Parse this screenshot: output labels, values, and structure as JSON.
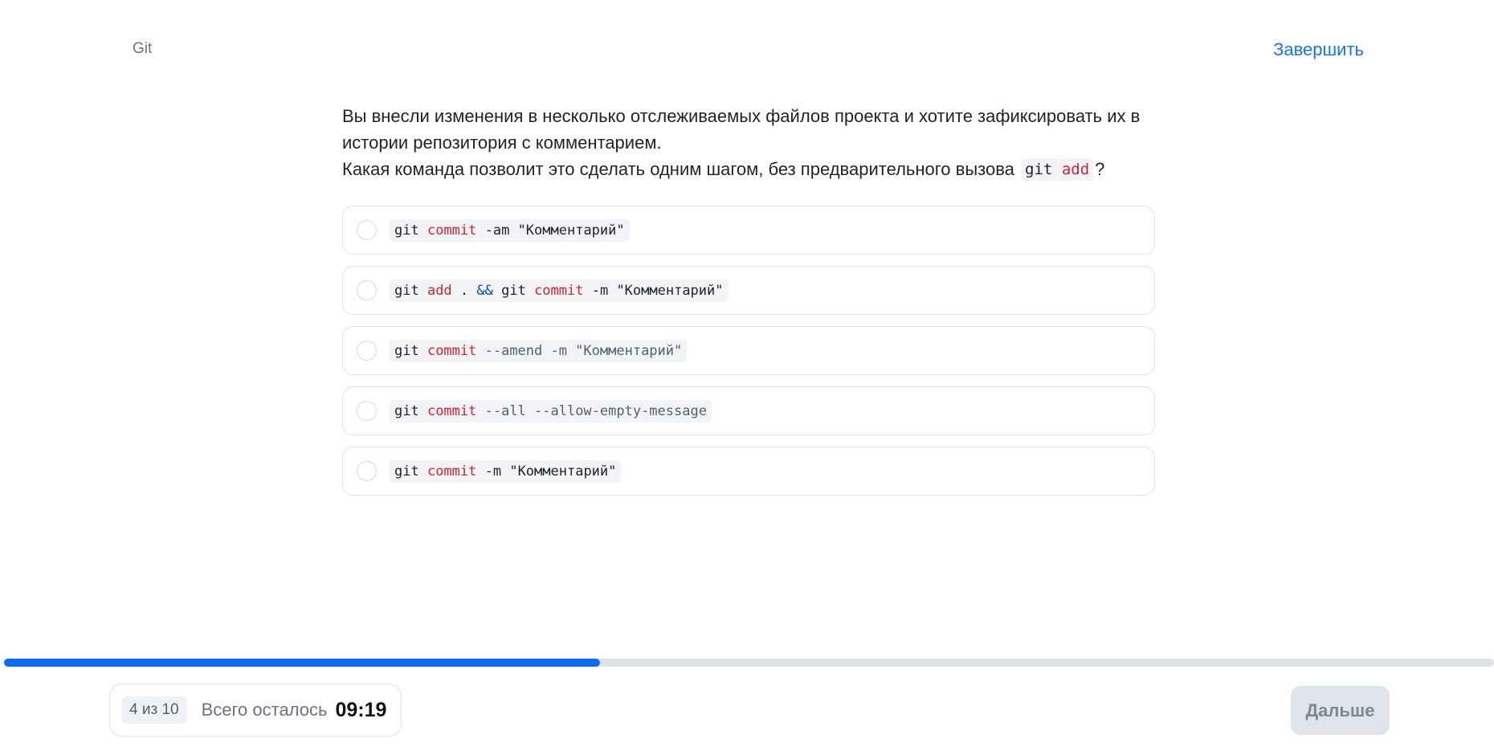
{
  "header": {
    "topic": "Git",
    "finish_label": "Завершить"
  },
  "question": {
    "line1": "Вы внесли изменения в несколько отслеживаемых файлов проекта и хотите зафиксировать их в",
    "line2": "истории репозитория с комментарием.",
    "line3_before": "Какая команда позволит это сделать одним шагом, без предварительного вызова",
    "code_git": "git",
    "code_add": "add",
    "line3_after": "?"
  },
  "options": [
    {
      "tokens": [
        {
          "t": "git ",
          "c": "plain"
        },
        {
          "t": "commit",
          "c": "kw"
        },
        {
          "t": " -am ",
          "c": "plain"
        },
        {
          "t": "\"Комментарий\"",
          "c": "str"
        }
      ]
    },
    {
      "tokens": [
        {
          "t": "git ",
          "c": "plain"
        },
        {
          "t": "add",
          "c": "kw"
        },
        {
          "t": " . ",
          "c": "plain"
        },
        {
          "t": "&&",
          "c": "op"
        },
        {
          "t": " git ",
          "c": "plain"
        },
        {
          "t": "commit",
          "c": "kw"
        },
        {
          "t": " -m ",
          "c": "plain"
        },
        {
          "t": "\"Комментарий\"",
          "c": "str"
        }
      ]
    },
    {
      "tokens": [
        {
          "t": "git ",
          "c": "plain"
        },
        {
          "t": "commit",
          "c": "kw"
        },
        {
          "t": " --amend -m \"Комментарий\"",
          "c": "flag"
        }
      ]
    },
    {
      "tokens": [
        {
          "t": "git ",
          "c": "plain"
        },
        {
          "t": "commit",
          "c": "kw"
        },
        {
          "t": " --all --allow-empty-message",
          "c": "flag"
        }
      ]
    },
    {
      "tokens": [
        {
          "t": "git ",
          "c": "plain"
        },
        {
          "t": "commit",
          "c": "kw"
        },
        {
          "t": " -m ",
          "c": "plain"
        },
        {
          "t": "\"Комментарий\"",
          "c": "str"
        }
      ]
    }
  ],
  "progress": {
    "fraction": 0.4
  },
  "footer": {
    "counter": "4 из 10",
    "remaining_label": "Всего осталось",
    "timer": "09:19",
    "next_label": "Дальше"
  },
  "colors": {
    "accent": "#0b6cf0",
    "link": "#1a73e8",
    "keyword": "#d1242f"
  }
}
